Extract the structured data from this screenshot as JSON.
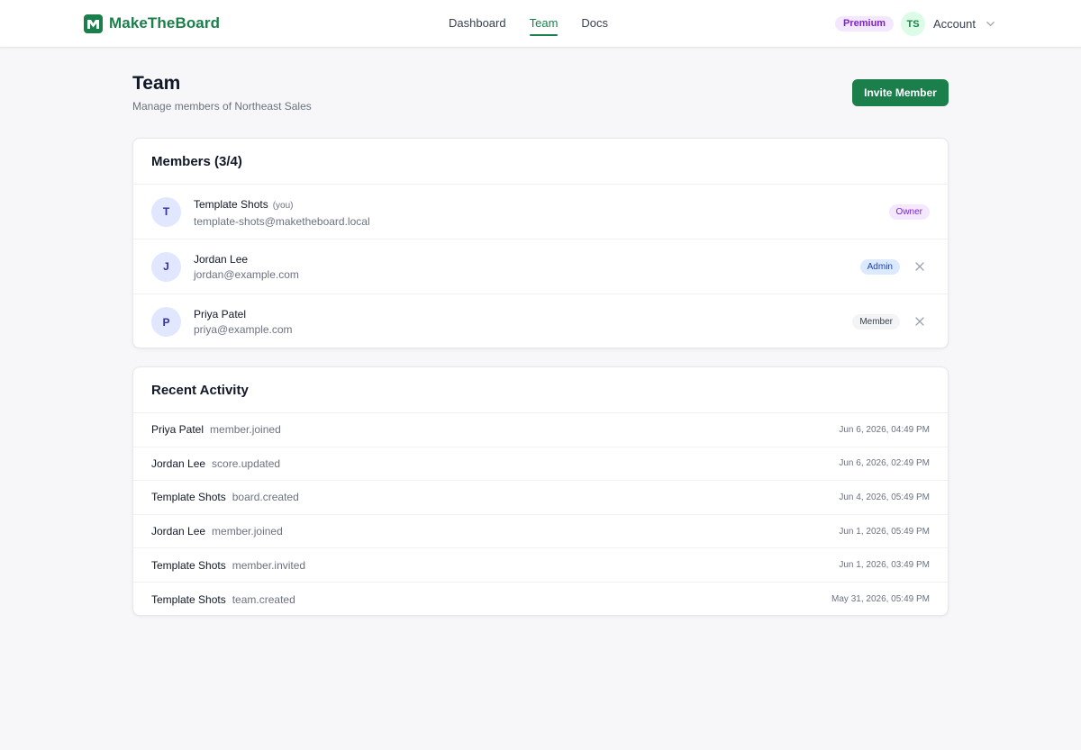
{
  "brand": {
    "name": "MakeTheBoard",
    "accent": "#1a7f4b"
  },
  "nav": {
    "items": [
      {
        "label": "Dashboard",
        "active": false
      },
      {
        "label": "Team",
        "active": true
      },
      {
        "label": "Docs",
        "active": false
      }
    ]
  },
  "account": {
    "plan_badge": "Premium",
    "initials": "TS",
    "label": "Account"
  },
  "page": {
    "title": "Team",
    "subtitle": "Manage members of Northeast Sales",
    "invite_label": "Invite Member"
  },
  "members": {
    "heading": "Members (3/4)",
    "list": [
      {
        "initial": "T",
        "name": "Template Shots",
        "you": "(you)",
        "email": "template-shots@maketheboard.local",
        "role": "Owner",
        "removable": false
      },
      {
        "initial": "J",
        "name": "Jordan Lee",
        "you": "",
        "email": "jordan@example.com",
        "role": "Admin",
        "removable": true
      },
      {
        "initial": "P",
        "name": "Priya Patel",
        "you": "",
        "email": "priya@example.com",
        "role": "Member",
        "removable": true
      }
    ]
  },
  "activity": {
    "heading": "Recent Activity",
    "list": [
      {
        "actor": "Priya Patel",
        "action": "member.joined",
        "time": "Jun 6, 2026, 04:49 PM"
      },
      {
        "actor": "Jordan Lee",
        "action": "score.updated",
        "time": "Jun 6, 2026, 02:49 PM"
      },
      {
        "actor": "Template Shots",
        "action": "board.created",
        "time": "Jun 4, 2026, 05:49 PM"
      },
      {
        "actor": "Jordan Lee",
        "action": "member.joined",
        "time": "Jun 1, 2026, 05:49 PM"
      },
      {
        "actor": "Template Shots",
        "action": "member.invited",
        "time": "Jun 1, 2026, 03:49 PM"
      },
      {
        "actor": "Template Shots",
        "action": "team.created",
        "time": "May 31, 2026, 05:49 PM"
      }
    ]
  }
}
